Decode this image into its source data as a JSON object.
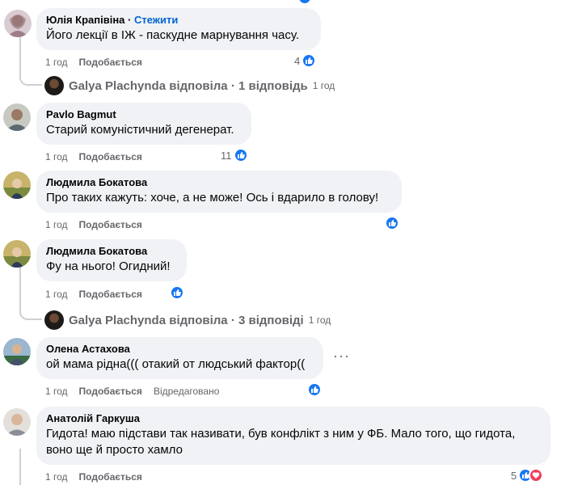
{
  "colors": {
    "like": "#1877f2",
    "love": "#f33e58",
    "bubble": "#f0f2f5",
    "meta": "#65676b",
    "follow": "#0064d1"
  },
  "comments": [
    {
      "author": "Юлія Крапівіна",
      "follow": "Стежити",
      "text": "Його лекції в ІЖ - паскудне марнування часу.",
      "time": "1 год",
      "like_action": "Подобається",
      "likes": "4"
    },
    {
      "author": "Pavlo Bagmut",
      "text": "Старий комуністичний дегенерат.",
      "time": "1 год",
      "like_action": "Подобається",
      "likes": "11"
    },
    {
      "author": "Людмила Бокатова",
      "text": "Про таких кажуть: хоче, а не може! Ось і вдарило в голову!",
      "time": "1 год",
      "like_action": "Подобається"
    },
    {
      "author": "Людмила Бокатова",
      "text": "Фу на нього! Огидний!",
      "time": "1 год",
      "like_action": "Подобається"
    },
    {
      "author": "Олена Астахова",
      "text": "ой мама рідна((( отакий от людський фактор((",
      "time": "1 год",
      "like_action": "Подобається",
      "edited": "Відредаговано"
    },
    {
      "author": "Анатолій Гаркуша",
      "text_line1": "Гидота! маю підстави так називати, був конфлікт з ним у ФБ. Мало того, що гидота,",
      "text_line2": "воно ще й просто хамло",
      "time": "1 год",
      "like_action": "Подобається",
      "likes": "5"
    }
  ],
  "replies": [
    {
      "name": "Galya Plachynda",
      "verb": "відповіла",
      "sep": "·",
      "count": "1 відповідь",
      "time": "1 год"
    },
    {
      "name": "Galya Plachynda",
      "verb": "відповіла",
      "sep": "·",
      "count": "3 відповіді",
      "time": "1 год"
    }
  ],
  "icons": {
    "like": "like-thumb-icon",
    "love": "heart-icon",
    "more": "more-dots-icon"
  }
}
